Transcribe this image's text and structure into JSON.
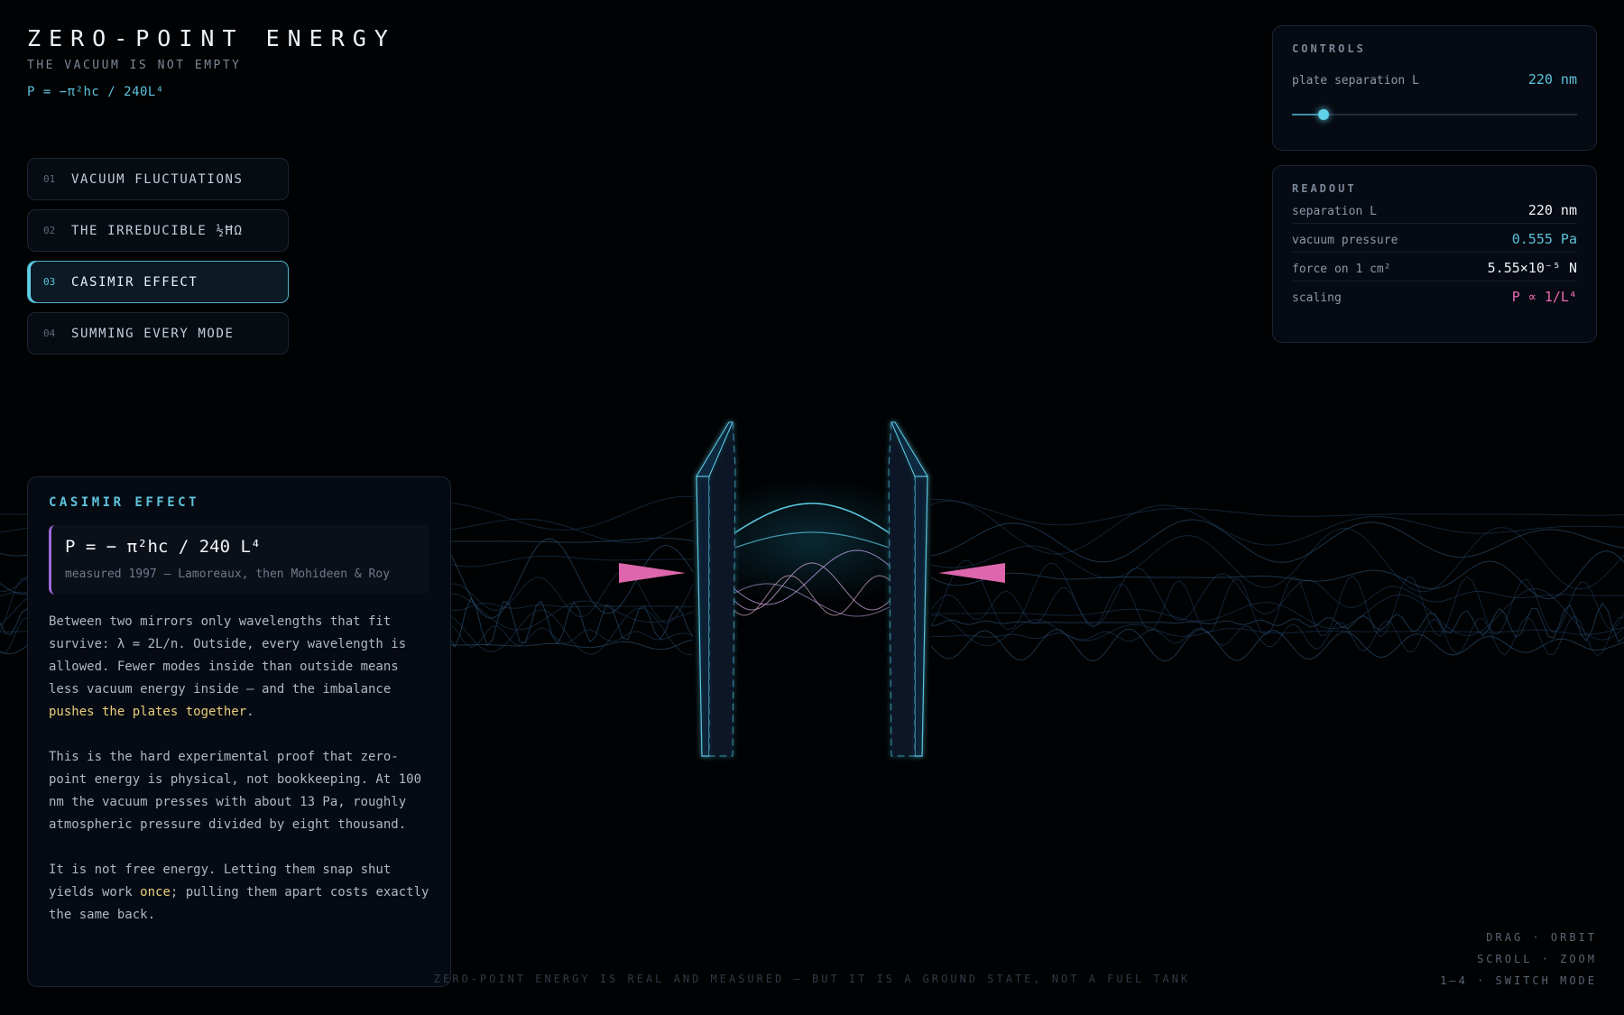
{
  "header": {
    "title": "ZERO-POINT ENERGY",
    "subtitle": "THE VACUUM IS NOT EMPTY",
    "formula": "P = −π²hc / 240L⁴"
  },
  "modes": [
    {
      "num": "01",
      "label": "VACUUM FLUCTUATIONS",
      "active": false
    },
    {
      "num": "02",
      "label": "THE IRREDUCIBLE ½ĦΩ",
      "active": false
    },
    {
      "num": "03",
      "label": "CASIMIR EFFECT",
      "active": true
    },
    {
      "num": "04",
      "label": "SUMMING EVERY MODE",
      "active": false
    }
  ],
  "controls": {
    "title": "CONTROLS",
    "separation_label": "plate separation L",
    "separation_value": "220 nm",
    "slider_fraction": 0.11
  },
  "readout": {
    "title": "READOUT",
    "rows": [
      {
        "key": "separation L",
        "value": "220 nm"
      },
      {
        "key": "vacuum pressure",
        "value": "0.555 Pa"
      },
      {
        "key": "force on 1 cm²",
        "value": "5.55×10⁻⁵ N"
      },
      {
        "key": "scaling",
        "value": "P ∝ 1/L⁴"
      }
    ]
  },
  "info": {
    "title": "CASIMIR EFFECT",
    "equation": "P = − π²hc / 240 L⁴",
    "equation_note": "measured 1997 — Lamoreaux, then Mohideen & Roy",
    "p1_a": "Between two mirrors only wavelengths that fit survive: λ = 2L/n. Outside, every wavelength is allowed. Fewer modes inside than outside means less vacuum energy inside — and the imbalance ",
    "p1_hl": "pushes the plates together",
    "p1_b": ".",
    "p2": "This is the hard experimental proof that zero-point energy is physical, not bookkeeping. At 100 nm the vacuum presses with about 13 Pa, roughly atmospheric pressure divided by eight thousand.",
    "p3_a": "It is not free energy. Letting them snap shut yields work ",
    "p3_hl": "once",
    "p3_b": "; pulling them apart costs exactly the same back."
  },
  "footer": {
    "tagline": "ZERO-POINT ENERGY IS REAL AND MEASURED — BUT IT IS A GROUND STATE, NOT A FUEL TANK"
  },
  "hints": [
    "DRAG · ORBIT",
    "SCROLL · ZOOM",
    "1–4 · SWITCH MODE"
  ],
  "colors": {
    "accent": "#5ec3dd",
    "pink": "#e96bb6",
    "highlight": "#e9cf7b",
    "violet": "#9a6bd8"
  },
  "icons": {
    "force_arrows": "force-arrow-icon"
  }
}
